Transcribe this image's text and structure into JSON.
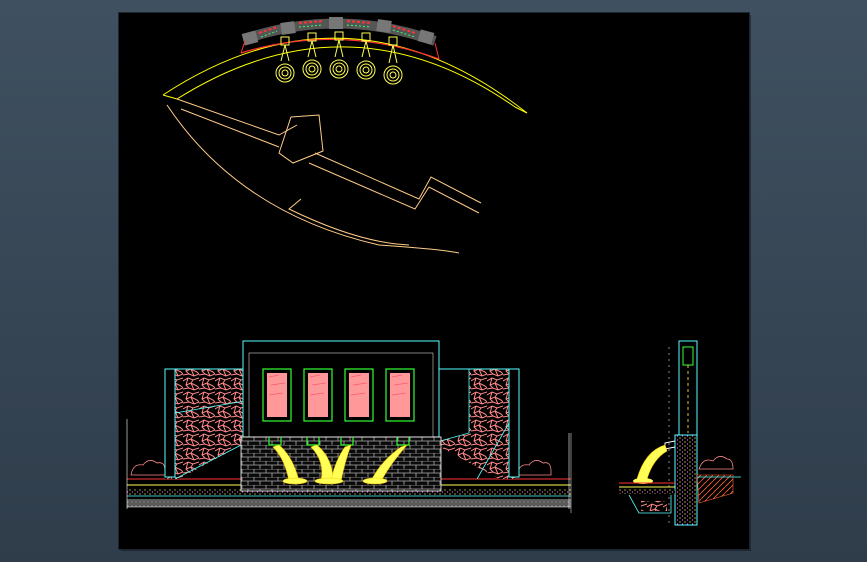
{
  "colors": {
    "app_background": "#3c4c5c",
    "sheet": "#000000",
    "water": "#ffff55",
    "stone": "#ff8888",
    "wall": "#55ffff",
    "outline": "#ffff00",
    "brick": "#aaaaaa",
    "soil": "#ff6633",
    "plan_lines": "#ffcc88",
    "panel_fill": "#ff9999",
    "panel_frame": "#33ff33"
  },
  "drawing": {
    "plan_view": {
      "nozzle_count": 5
    },
    "front_elevation": {
      "panel_count": 4,
      "spout_count": 4
    },
    "side_section": {
      "spout_count": 1
    }
  }
}
